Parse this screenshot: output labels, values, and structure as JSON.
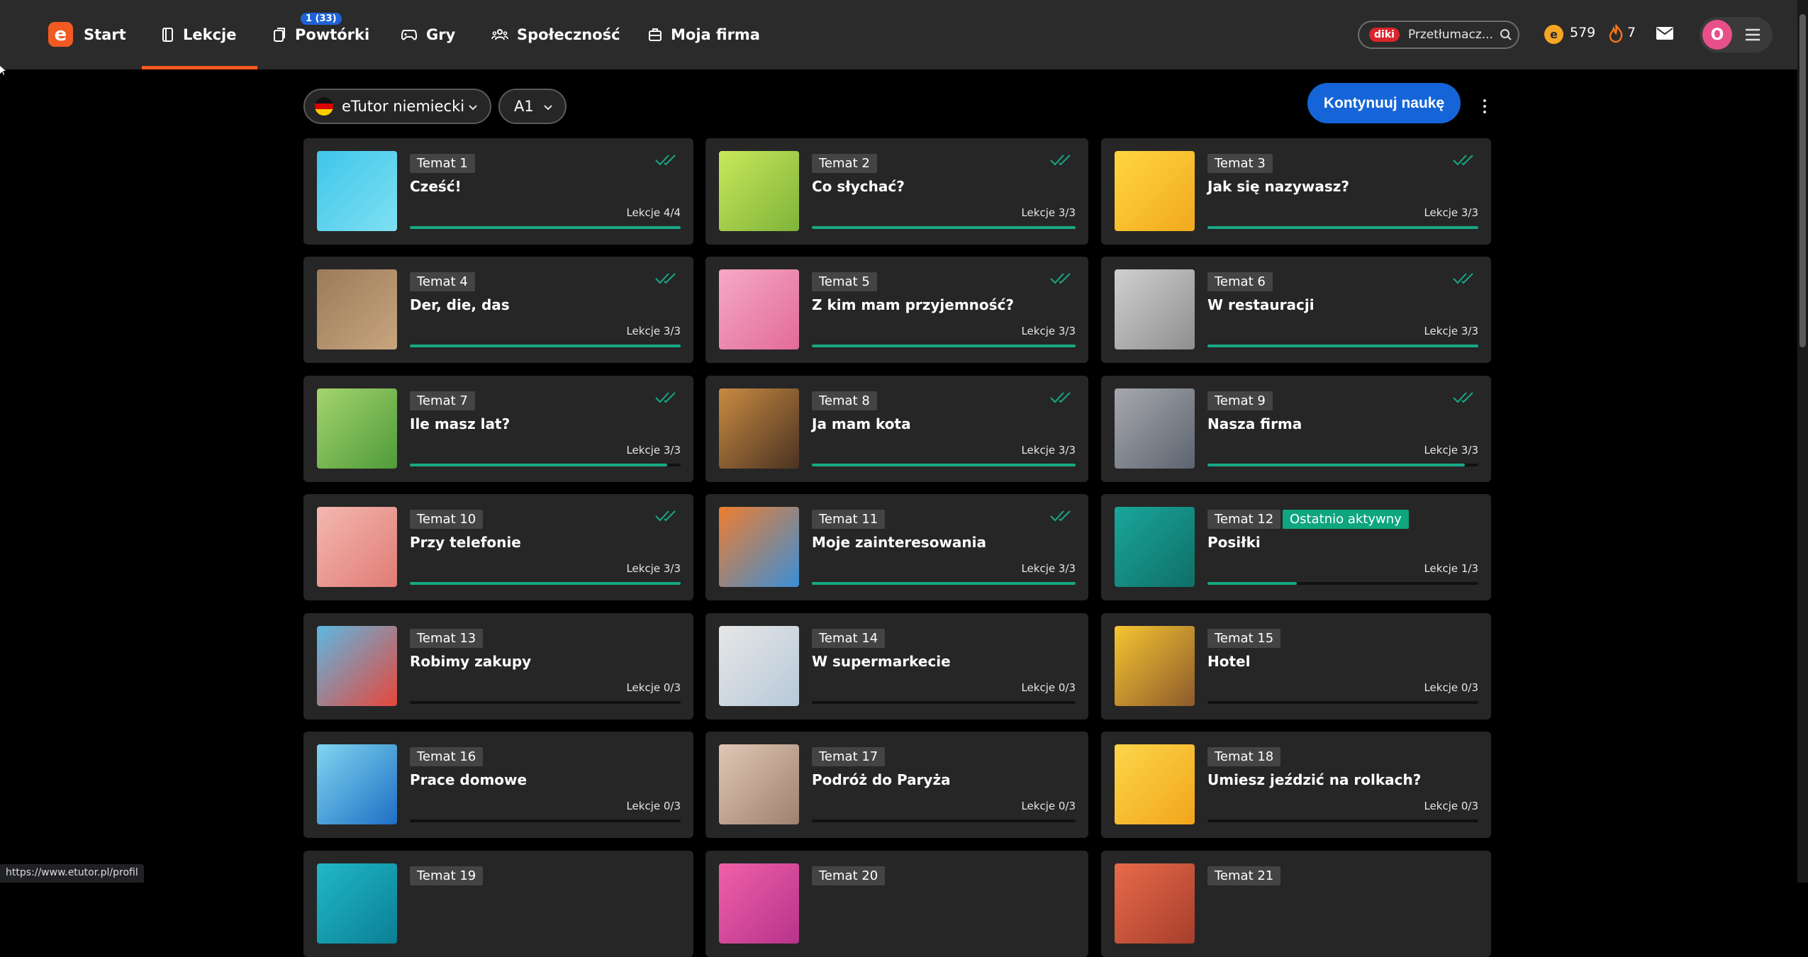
{
  "nav": {
    "start": "Start",
    "lessons": "Lekcje",
    "reviews": "Powtórki",
    "reviews_badge": "1 (33)",
    "games": "Gry",
    "community": "Społeczność",
    "company": "Moja firma",
    "logo_letter": "e"
  },
  "dictionary": {
    "brand": "diki",
    "placeholder": "Przetłumacz..."
  },
  "stats": {
    "coins": "579",
    "streak": "7"
  },
  "user": {
    "initial": "O"
  },
  "filters": {
    "course": "eTutor niemiecki",
    "level": "A1"
  },
  "continue_label": "Kontynuuj naukę",
  "status_url": "https://www.etutor.pl/profil",
  "colors": {
    "accent": "#f15a22",
    "primary": "#1565d8",
    "progress": "#17a884",
    "recent_badge": "#0fa57f"
  },
  "topics": [
    {
      "label": "Temat 1",
      "title": "Cześć!",
      "lessons": "Lekcje 4/4",
      "progress": 1.0,
      "done": true
    },
    {
      "label": "Temat 2",
      "title": "Co słychać?",
      "lessons": "Lekcje 3/3",
      "progress": 1.0,
      "done": true
    },
    {
      "label": "Temat 3",
      "title": "Jak się nazywasz?",
      "lessons": "Lekcje 3/3",
      "progress": 1.0,
      "done": true
    },
    {
      "label": "Temat 4",
      "title": "Der, die, das",
      "lessons": "Lekcje 3/3",
      "progress": 1.0,
      "done": true
    },
    {
      "label": "Temat 5",
      "title": "Z kim mam przyjemność?",
      "lessons": "Lekcje 3/3",
      "progress": 1.0,
      "done": true
    },
    {
      "label": "Temat 6",
      "title": "W restauracji",
      "lessons": "Lekcje 3/3",
      "progress": 1.0,
      "done": true
    },
    {
      "label": "Temat 7",
      "title": "Ile masz lat?",
      "lessons": "Lekcje 3/3",
      "progress": 0.95,
      "done": true
    },
    {
      "label": "Temat 8",
      "title": "Ja mam kota",
      "lessons": "Lekcje 3/3",
      "progress": 1.0,
      "done": true
    },
    {
      "label": "Temat 9",
      "title": "Nasza firma",
      "lessons": "Lekcje 3/3",
      "progress": 0.95,
      "done": true
    },
    {
      "label": "Temat 10",
      "title": "Przy telefonie",
      "lessons": "Lekcje 3/3",
      "progress": 1.0,
      "done": true
    },
    {
      "label": "Temat 11",
      "title": "Moje zainteresowania",
      "lessons": "Lekcje 3/3",
      "progress": 1.0,
      "done": true
    },
    {
      "label": "Temat 12",
      "title": "Posiłki",
      "lessons": "Lekcje 1/3",
      "progress": 0.33,
      "done": false,
      "badge": "Ostatnio aktywny"
    },
    {
      "label": "Temat 13",
      "title": "Robimy zakupy",
      "lessons": "Lekcje 0/3",
      "progress": 0,
      "done": false
    },
    {
      "label": "Temat 14",
      "title": "W supermarkecie",
      "lessons": "Lekcje 0/3",
      "progress": 0,
      "done": false
    },
    {
      "label": "Temat 15",
      "title": "Hotel",
      "lessons": "Lekcje 0/3",
      "progress": 0,
      "done": false
    },
    {
      "label": "Temat 16",
      "title": "Prace domowe",
      "lessons": "Lekcje 0/3",
      "progress": 0,
      "done": false
    },
    {
      "label": "Temat 17",
      "title": "Podróż do Paryża",
      "lessons": "Lekcje 0/3",
      "progress": 0,
      "done": false
    },
    {
      "label": "Temat 18",
      "title": "Umiesz jeździć na rolkach?",
      "lessons": "Lekcje 0/3",
      "progress": 0,
      "done": false
    },
    {
      "label": "Temat 19",
      "title": "",
      "lessons": "",
      "progress": 0,
      "done": false
    },
    {
      "label": "Temat 20",
      "title": "",
      "lessons": "",
      "progress": 0,
      "done": false
    },
    {
      "label": "Temat 21",
      "title": "",
      "lessons": "",
      "progress": 0,
      "done": false
    }
  ]
}
